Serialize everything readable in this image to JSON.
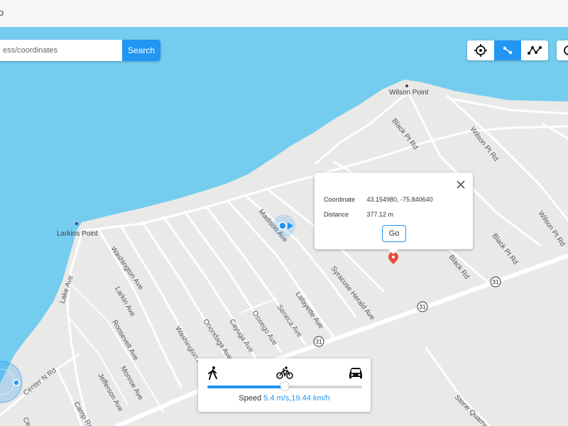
{
  "window": {
    "caption": "o"
  },
  "search": {
    "placeholder": "ess/coordinates",
    "button_label": "Search"
  },
  "toolbar": {
    "modes": [
      {
        "name": "crosshair-icon",
        "active": false
      },
      {
        "name": "route-two-point-icon",
        "active": true
      },
      {
        "name": "route-multi-point-icon",
        "active": false
      }
    ]
  },
  "map": {
    "colors": {
      "water": "#74cdef",
      "land": "#e9e9e7",
      "road": "#ffffff",
      "accent": "#2196f3",
      "marker": "#ea4a3a"
    },
    "places": [
      "Wilson Point",
      "Larkins Point"
    ],
    "roads": [
      "Black Pt Rd",
      "Wilson Pt Rd",
      "Wilson Pt Rd",
      "Black Pt Rd",
      "Black Rd",
      "Madison Ave",
      "Syracuse Herald Ave",
      "Lafayette Ave",
      "Seneca Ave",
      "Oswego Ave",
      "Cayuga Ave",
      "Onondaga Ave",
      "Washington Ave",
      "Washington Ave",
      "Larkin Ave",
      "Roosevelt Ave",
      "Monroe Ave",
      "Jefferson Ave",
      "Lake Ave",
      "Center N Rd",
      "Camp Rd",
      "Stone Quarry",
      "Ce"
    ],
    "route_shields": [
      "31",
      "31",
      "31"
    ]
  },
  "popup": {
    "coordinate_label": "Coordinate",
    "coordinate_value": "43.154980, -75.840640",
    "distance_label": "Distance",
    "distance_value": "377.12 m",
    "go_label": "Go"
  },
  "speed": {
    "label": "Speed",
    "value_text": "5.4 m/s,19.44 km/h",
    "slider_fraction": 0.5,
    "modes": [
      "walk-icon",
      "bike-icon",
      "car-icon"
    ]
  }
}
